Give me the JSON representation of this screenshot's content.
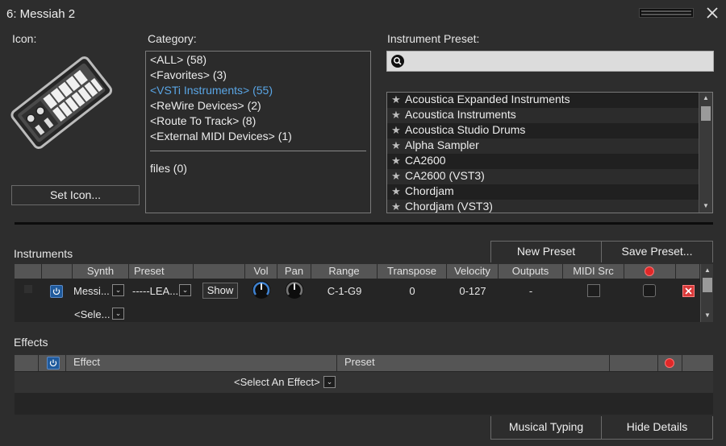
{
  "window": {
    "title": "6: Messiah 2"
  },
  "icon_section": {
    "label": "Icon:",
    "set_icon_button": "Set Icon..."
  },
  "category": {
    "label": "Category:",
    "items": [
      "<ALL> (58)",
      "<Favorites> (3)",
      "<VSTi Instruments> (55)",
      "<ReWire Devices> (2)",
      "<Route To Track> (8)",
      "<External MIDI Devices> (1)"
    ],
    "selected_index": 2,
    "extra_items": [
      "files (0)"
    ]
  },
  "instrument_preset": {
    "label": "Instrument Preset:",
    "search_value": "",
    "items": [
      "Acoustica Expanded Instruments",
      "Acoustica Instruments",
      "Acoustica Studio Drums",
      "Alpha Sampler",
      "CA2600",
      "CA2600 (VST3)",
      "Chordjam",
      "Chordjam (VST3)"
    ]
  },
  "instruments": {
    "label": "Instruments",
    "new_preset_button": "New Preset",
    "save_preset_button": "Save Preset...",
    "columns": [
      "Synth",
      "Preset",
      "Vol",
      "Pan",
      "Range",
      "Transpose",
      "Velocity",
      "Outputs",
      "MIDI Src"
    ],
    "row": {
      "synth": "Messi...",
      "preset": "-----LEA...",
      "show_button": "Show",
      "range": "C-1-G9",
      "transpose": "0",
      "velocity": "0-127",
      "outputs": "-"
    },
    "select_placeholder": "<Sele..."
  },
  "effects": {
    "label": "Effects",
    "columns": [
      "Effect",
      "Preset"
    ],
    "select_placeholder": "<Select An Effect>"
  },
  "footer": {
    "musical_typing_button": "Musical Typing",
    "hide_details_button": "Hide Details"
  },
  "colors": {
    "background": "#2d2d2d",
    "selected_category": "#5aa6e6",
    "record": "#e02828",
    "power": "#1f5a9c",
    "delete": "#d93a3a"
  },
  "icons": [
    "close-icon",
    "keyboard-controller-icon",
    "search-icon",
    "star-icon",
    "power-icon",
    "record-icon",
    "delete-icon",
    "chevron-down-icon",
    "scroll-up-icon",
    "scroll-down-icon"
  ]
}
